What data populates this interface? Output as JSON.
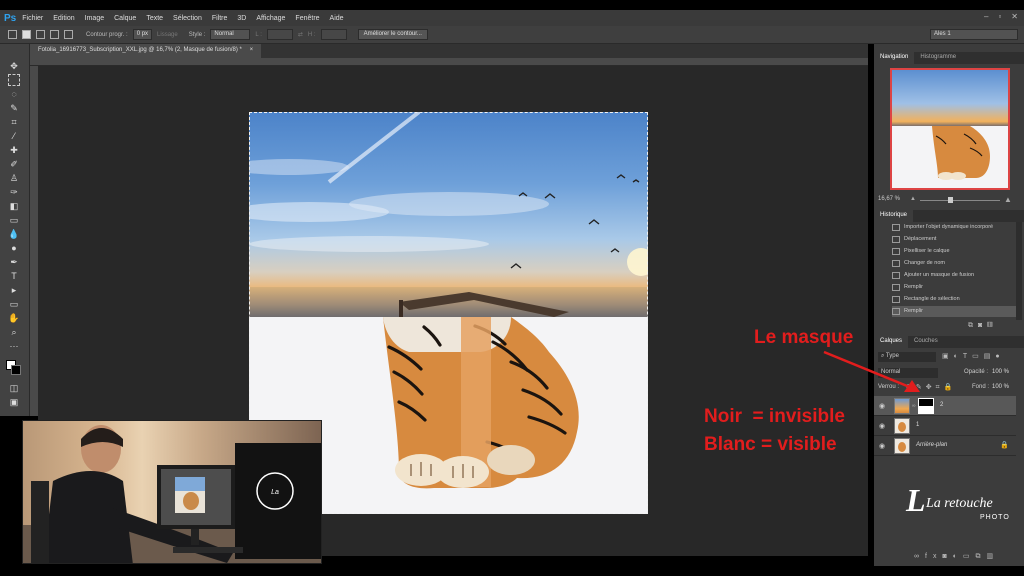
{
  "app": {
    "logo": "Ps",
    "menu": [
      "Fichier",
      "Edition",
      "Image",
      "Calque",
      "Texte",
      "Sélection",
      "Filtre",
      "3D",
      "Affichage",
      "Fenêtre",
      "Aide"
    ],
    "window_controls": [
      "–",
      "▫",
      "✕"
    ]
  },
  "options": {
    "contour_label": "Contour progr. :",
    "contour_value": "0 px",
    "lissage_label": "Lissage",
    "style_label": "Style :",
    "style_value": "Normal",
    "l_label": "L :",
    "h_label": "H :",
    "refine_button": "Améliorer le contour...",
    "workspace": "Ales 1"
  },
  "document": {
    "tab_title": "Fotolia_16916773_Subscription_XXL.jpg @ 16,7% (2, Masque de fusion/8) *",
    "tab_close": "×"
  },
  "tools": [
    "move-tool",
    "marquee-tool",
    "lasso-tool",
    "quick-select-tool",
    "crop-tool",
    "eyedropper-tool",
    "healing-tool",
    "brush-tool",
    "stamp-tool",
    "history-brush-tool",
    "eraser-tool",
    "gradient-tool",
    "blur-tool",
    "dodge-tool",
    "pen-tool",
    "type-tool",
    "path-select-tool",
    "shape-tool",
    "hand-tool",
    "zoom-tool"
  ],
  "navigator": {
    "tab_navigation": "Navigation",
    "tab_histogram": "Histogramme",
    "zoom_value": "16,67 %"
  },
  "history": {
    "title": "Historique",
    "items": [
      "Importer l'objet dynamique incorporé",
      "Déplacement",
      "Pixelliser le calque",
      "Changer de nom",
      "Ajouter un masque de fusion",
      "Remplir",
      "Rectangle de sélection",
      "Remplir"
    ]
  },
  "layers": {
    "tab_layers": "Calques",
    "tab_channels": "Couches",
    "filter_kind": "Type",
    "blend_mode": "Normal",
    "opacity_label": "Opacité :",
    "opacity_value": "100 %",
    "lock_label": "Verrou :",
    "fill_label": "Fond :",
    "fill_value": "100 %",
    "items": [
      {
        "name": "2"
      },
      {
        "name": "1"
      },
      {
        "name": "Arrière-plan"
      }
    ]
  },
  "annotations": {
    "mask_label": "Le masque",
    "line1": "Noir  = invisible",
    "line2": "Blanc = visible"
  },
  "branding": {
    "logo_main": "La retouche",
    "logo_sub": "PHOTO"
  },
  "colors": {
    "annotation_red": "#e21d1d",
    "ps_blue": "#2fa3f0",
    "panel_bg": "#3c3c3c",
    "canvas_bg": "#282828"
  }
}
